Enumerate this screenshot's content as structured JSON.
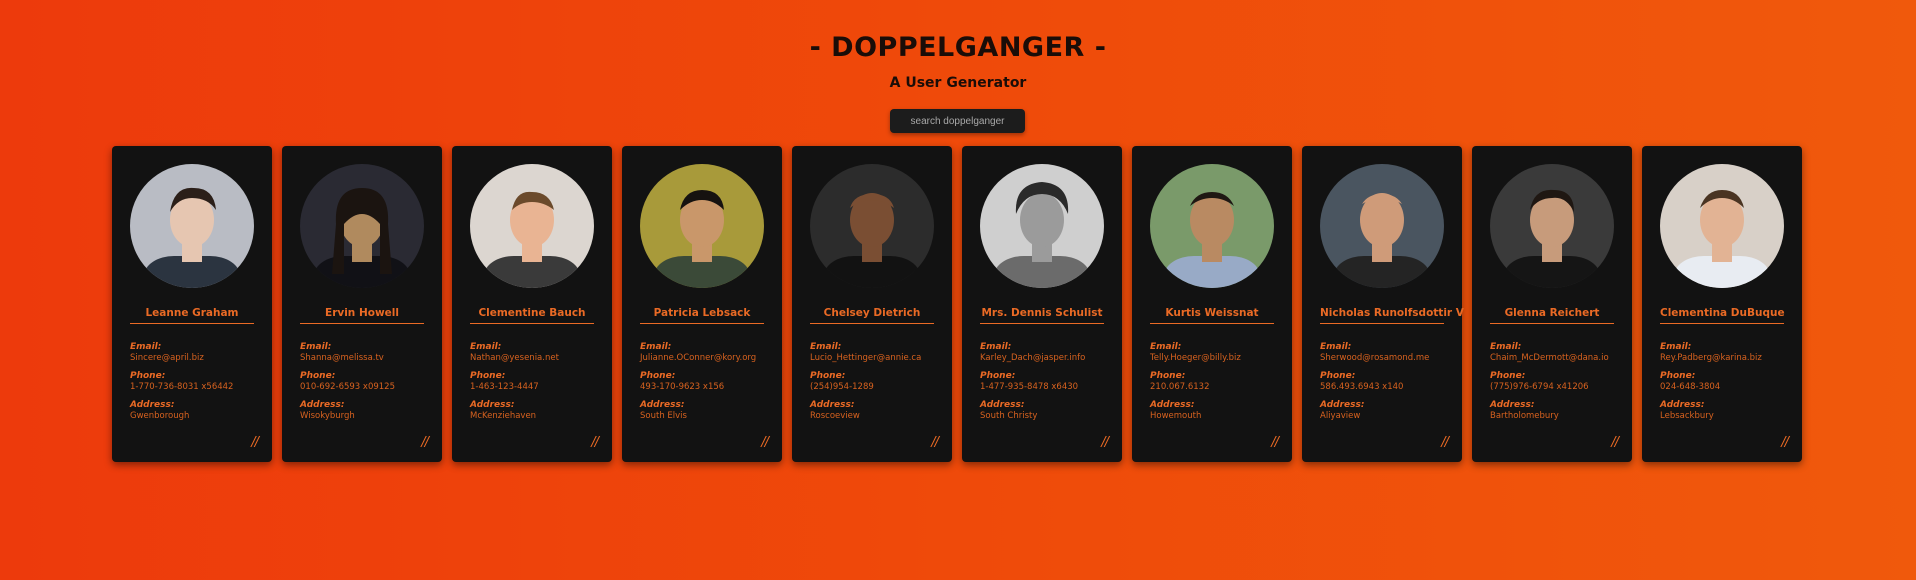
{
  "header": {
    "title": "- DOPPELGANGER -",
    "subtitle": "A User Generator"
  },
  "search": {
    "placeholder": "search doppelganger",
    "value": ""
  },
  "labels": {
    "email": "Email:",
    "phone": "Phone:",
    "address": "Address:",
    "edit": "//"
  },
  "colors": {
    "background_start": "#ed3a0c",
    "background_end": "#f0590c",
    "card": "#121212",
    "accent": "#ea6a25"
  },
  "users": [
    {
      "name": "Leanne Graham",
      "email": "Sincere@april.biz",
      "phone": "1-770-736-8031 x56442",
      "address": "Gwenborough",
      "photo": "portrait-photo-young-man-suit"
    },
    {
      "name": "Ervin Howell",
      "email": "Shanna@melissa.tv",
      "phone": "010-692-6593 x09125",
      "address": "Wisokyburgh",
      "photo": "portrait-photo-man-long-hair"
    },
    {
      "name": "Clementine Bauch",
      "email": "Nathan@yesenia.net",
      "phone": "1-463-123-4447",
      "address": "McKenziehaven",
      "photo": "portrait-photo-man-excited"
    },
    {
      "name": "Patricia Lebsack",
      "email": "Julianne.OConner@kory.org",
      "phone": "493-170-9623 x156",
      "address": "South Elvis",
      "photo": "portrait-photo-man-jacket-outdoors"
    },
    {
      "name": "Chelsey Dietrich",
      "email": "Lucio_Hettinger@annie.ca",
      "phone": "(254)954-1289",
      "address": "Roscoeview",
      "photo": "portrait-photo-bald-man-dark"
    },
    {
      "name": "Mrs. Dennis Schulist",
      "email": "Karley_Dach@jasper.info",
      "phone": "1-477-935-8478 x6430",
      "address": "South Christy",
      "photo": "portrait-photo-man-grayscale-sunglasses"
    },
    {
      "name": "Kurtis Weissnat",
      "email": "Telly.Hoeger@billy.biz",
      "phone": "210.067.6132",
      "address": "Howemouth",
      "photo": "portrait-photo-man-beard-outdoors"
    },
    {
      "name": "Nicholas Runolfsdottir V",
      "email": "Sherwood@rosamond.me",
      "phone": "586.493.6943 x140",
      "address": "Aliyaview",
      "photo": "portrait-photo-bald-man-closeup"
    },
    {
      "name": "Glenna Reichert",
      "email": "Chaim_McDermott@dana.io",
      "phone": "(775)976-6794 x41206",
      "address": "Bartholomebury",
      "photo": "portrait-photo-man-dark-background"
    },
    {
      "name": "Clementina DuBuque",
      "email": "Rey.Padberg@karina.biz",
      "phone": "024-648-3804",
      "address": "Lebsackbury",
      "photo": "portrait-photo-man-white-shirt"
    }
  ]
}
